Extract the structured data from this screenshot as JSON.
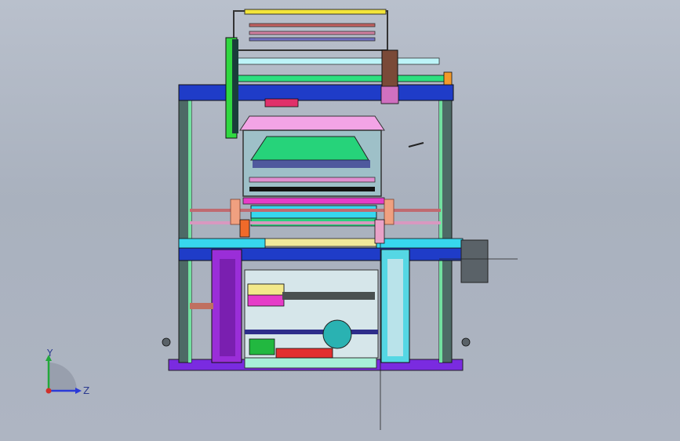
{
  "triad": {
    "y_label": "Y",
    "z_label": "Z"
  },
  "colors": {
    "background": "#aeb5c2",
    "frame_blue": "#1f3cc8",
    "frame_dark": "#4a5a5a",
    "magenta": "#e63cc8",
    "cyan": "#37d7ee",
    "green": "#22d86e",
    "purple": "#8a2be2",
    "pink": "#f0a0d8",
    "yellow": "#f3e53a"
  },
  "model": {
    "name": "loom-assembly-front-view"
  }
}
